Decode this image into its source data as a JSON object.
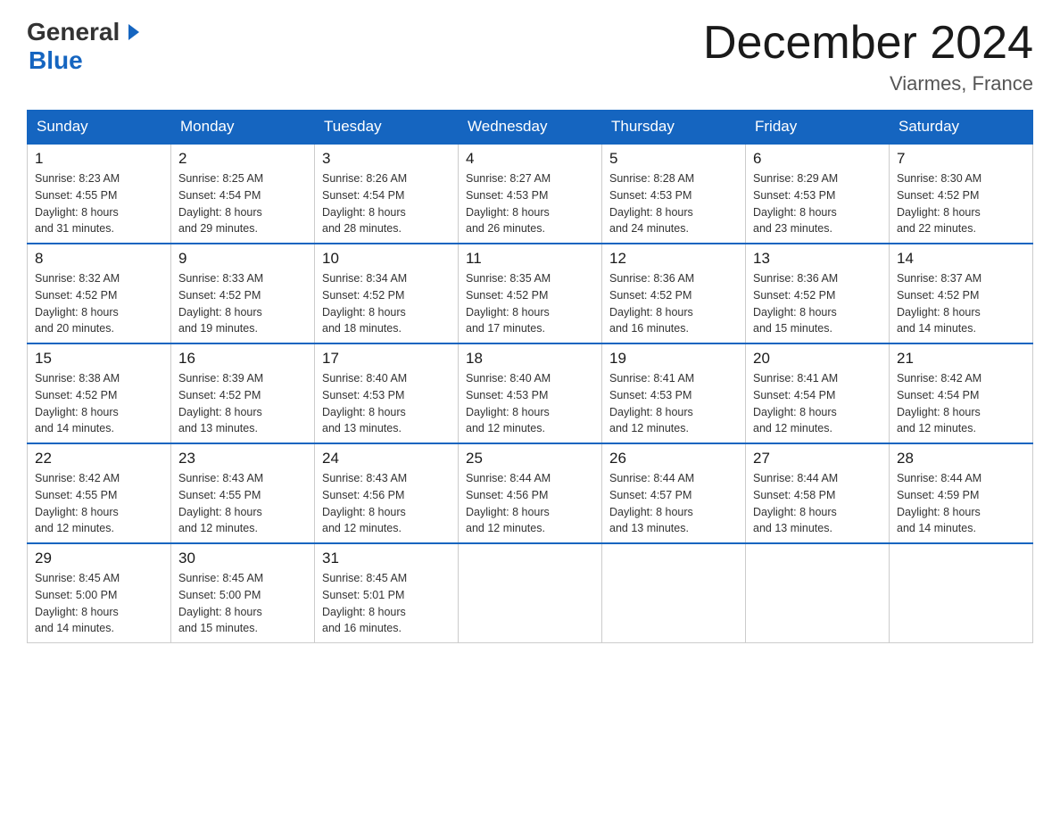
{
  "header": {
    "logo_line1": "General",
    "logo_line2": "Blue",
    "title": "December 2024",
    "subtitle": "Viarmes, France"
  },
  "calendar": {
    "days_of_week": [
      "Sunday",
      "Monday",
      "Tuesday",
      "Wednesday",
      "Thursday",
      "Friday",
      "Saturday"
    ],
    "weeks": [
      [
        {
          "day": "1",
          "sunrise": "8:23 AM",
          "sunset": "4:55 PM",
          "daylight": "8 hours and 31 minutes."
        },
        {
          "day": "2",
          "sunrise": "8:25 AM",
          "sunset": "4:54 PM",
          "daylight": "8 hours and 29 minutes."
        },
        {
          "day": "3",
          "sunrise": "8:26 AM",
          "sunset": "4:54 PM",
          "daylight": "8 hours and 28 minutes."
        },
        {
          "day": "4",
          "sunrise": "8:27 AM",
          "sunset": "4:53 PM",
          "daylight": "8 hours and 26 minutes."
        },
        {
          "day": "5",
          "sunrise": "8:28 AM",
          "sunset": "4:53 PM",
          "daylight": "8 hours and 24 minutes."
        },
        {
          "day": "6",
          "sunrise": "8:29 AM",
          "sunset": "4:53 PM",
          "daylight": "8 hours and 23 minutes."
        },
        {
          "day": "7",
          "sunrise": "8:30 AM",
          "sunset": "4:52 PM",
          "daylight": "8 hours and 22 minutes."
        }
      ],
      [
        {
          "day": "8",
          "sunrise": "8:32 AM",
          "sunset": "4:52 PM",
          "daylight": "8 hours and 20 minutes."
        },
        {
          "day": "9",
          "sunrise": "8:33 AM",
          "sunset": "4:52 PM",
          "daylight": "8 hours and 19 minutes."
        },
        {
          "day": "10",
          "sunrise": "8:34 AM",
          "sunset": "4:52 PM",
          "daylight": "8 hours and 18 minutes."
        },
        {
          "day": "11",
          "sunrise": "8:35 AM",
          "sunset": "4:52 PM",
          "daylight": "8 hours and 17 minutes."
        },
        {
          "day": "12",
          "sunrise": "8:36 AM",
          "sunset": "4:52 PM",
          "daylight": "8 hours and 16 minutes."
        },
        {
          "day": "13",
          "sunrise": "8:36 AM",
          "sunset": "4:52 PM",
          "daylight": "8 hours and 15 minutes."
        },
        {
          "day": "14",
          "sunrise": "8:37 AM",
          "sunset": "4:52 PM",
          "daylight": "8 hours and 14 minutes."
        }
      ],
      [
        {
          "day": "15",
          "sunrise": "8:38 AM",
          "sunset": "4:52 PM",
          "daylight": "8 hours and 14 minutes."
        },
        {
          "day": "16",
          "sunrise": "8:39 AM",
          "sunset": "4:52 PM",
          "daylight": "8 hours and 13 minutes."
        },
        {
          "day": "17",
          "sunrise": "8:40 AM",
          "sunset": "4:53 PM",
          "daylight": "8 hours and 13 minutes."
        },
        {
          "day": "18",
          "sunrise": "8:40 AM",
          "sunset": "4:53 PM",
          "daylight": "8 hours and 12 minutes."
        },
        {
          "day": "19",
          "sunrise": "8:41 AM",
          "sunset": "4:53 PM",
          "daylight": "8 hours and 12 minutes."
        },
        {
          "day": "20",
          "sunrise": "8:41 AM",
          "sunset": "4:54 PM",
          "daylight": "8 hours and 12 minutes."
        },
        {
          "day": "21",
          "sunrise": "8:42 AM",
          "sunset": "4:54 PM",
          "daylight": "8 hours and 12 minutes."
        }
      ],
      [
        {
          "day": "22",
          "sunrise": "8:42 AM",
          "sunset": "4:55 PM",
          "daylight": "8 hours and 12 minutes."
        },
        {
          "day": "23",
          "sunrise": "8:43 AM",
          "sunset": "4:55 PM",
          "daylight": "8 hours and 12 minutes."
        },
        {
          "day": "24",
          "sunrise": "8:43 AM",
          "sunset": "4:56 PM",
          "daylight": "8 hours and 12 minutes."
        },
        {
          "day": "25",
          "sunrise": "8:44 AM",
          "sunset": "4:56 PM",
          "daylight": "8 hours and 12 minutes."
        },
        {
          "day": "26",
          "sunrise": "8:44 AM",
          "sunset": "4:57 PM",
          "daylight": "8 hours and 13 minutes."
        },
        {
          "day": "27",
          "sunrise": "8:44 AM",
          "sunset": "4:58 PM",
          "daylight": "8 hours and 13 minutes."
        },
        {
          "day": "28",
          "sunrise": "8:44 AM",
          "sunset": "4:59 PM",
          "daylight": "8 hours and 14 minutes."
        }
      ],
      [
        {
          "day": "29",
          "sunrise": "8:45 AM",
          "sunset": "5:00 PM",
          "daylight": "8 hours and 14 minutes."
        },
        {
          "day": "30",
          "sunrise": "8:45 AM",
          "sunset": "5:00 PM",
          "daylight": "8 hours and 15 minutes."
        },
        {
          "day": "31",
          "sunrise": "8:45 AM",
          "sunset": "5:01 PM",
          "daylight": "8 hours and 16 minutes."
        },
        null,
        null,
        null,
        null
      ]
    ],
    "labels": {
      "sunrise": "Sunrise:",
      "sunset": "Sunset:",
      "daylight": "Daylight:"
    }
  }
}
